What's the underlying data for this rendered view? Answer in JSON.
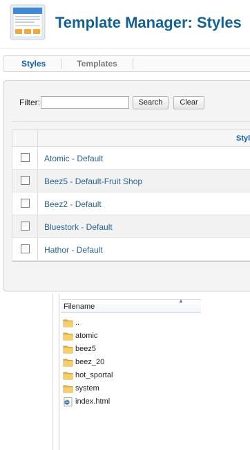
{
  "header": {
    "title": "Template Manager: Styles",
    "icon": "template-manager-icon"
  },
  "tabs": [
    {
      "label": "Styles",
      "active": true
    },
    {
      "label": "Templates",
      "active": false
    }
  ],
  "filter": {
    "label": "Filter:",
    "value": "",
    "search_label": "Search",
    "clear_label": "Clear"
  },
  "table": {
    "column_style": "Style",
    "rows": [
      {
        "name": "Atomic - Default"
      },
      {
        "name": "Beez5 - Default-Fruit Shop"
      },
      {
        "name": "Beez2 - Default"
      },
      {
        "name": "Bluestork - Default"
      },
      {
        "name": "Hathor - Default"
      }
    ]
  },
  "explorer": {
    "column_header": "Filename",
    "files": [
      {
        "name": "..",
        "icon": "folder-icon"
      },
      {
        "name": "atomic",
        "icon": "folder-icon"
      },
      {
        "name": "beez5",
        "icon": "folder-icon"
      },
      {
        "name": "beez_20",
        "icon": "folder-icon"
      },
      {
        "name": "hot_sportal",
        "icon": "folder-icon"
      },
      {
        "name": "system",
        "icon": "folder-icon"
      },
      {
        "name": "index.html",
        "icon": "html-file-icon"
      }
    ]
  },
  "colors": {
    "title": "#146295",
    "link": "#2a6496",
    "active_tab": "#135cae"
  }
}
